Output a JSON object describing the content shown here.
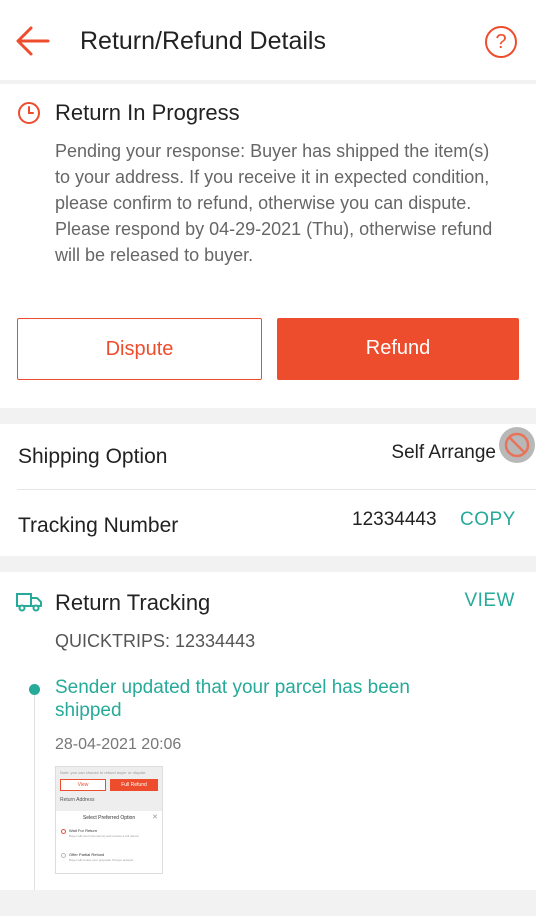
{
  "colors": {
    "accent": "#ee4d2d",
    "teal": "#26aa99"
  },
  "header": {
    "title": "Return/Refund Details",
    "help_glyph": "?",
    "back_icon": "arrow-left-icon",
    "help_icon": "help-icon"
  },
  "status": {
    "icon": "clock-icon",
    "title": "Return In Progress",
    "description": "Pending your response: Buyer has shipped the item(s) to your address. If you receive it in expected condition, please confirm to refund, otherwise you can dispute. Please respond by 04-29-2021 (Thu), otherwise refund will be released to buyer.",
    "dispute_label": "Dispute",
    "refund_label": "Refund"
  },
  "shipping": {
    "option_label": "Shipping Option",
    "option_value": "Self Arrange",
    "tracking_label": "Tracking Number",
    "tracking_value": "12334443",
    "copy_label": "COPY"
  },
  "return_tracking": {
    "icon": "truck-icon",
    "title": "Return Tracking",
    "view_label": "VIEW",
    "courier": "QUICKTRIPS: 12334443",
    "events": [
      {
        "text": "Sender updated that your parcel has been shipped",
        "time": "28-04-2021 20:06"
      }
    ],
    "attachment": {
      "note": "Note: you can choose to refund buyer or dispute.",
      "button_dispute": "View",
      "button_refund": "Full Refund",
      "address_label": "Return Address",
      "panel_title": "Select Preferred Option",
      "option1": "Wait For Return",
      "option1_sub": "Buyer will return the item(s) and receive a full refund",
      "option2": "Offer Partial Refund",
      "option2_sub": "Buyer will review your proposal. If buyer accepts"
    }
  }
}
